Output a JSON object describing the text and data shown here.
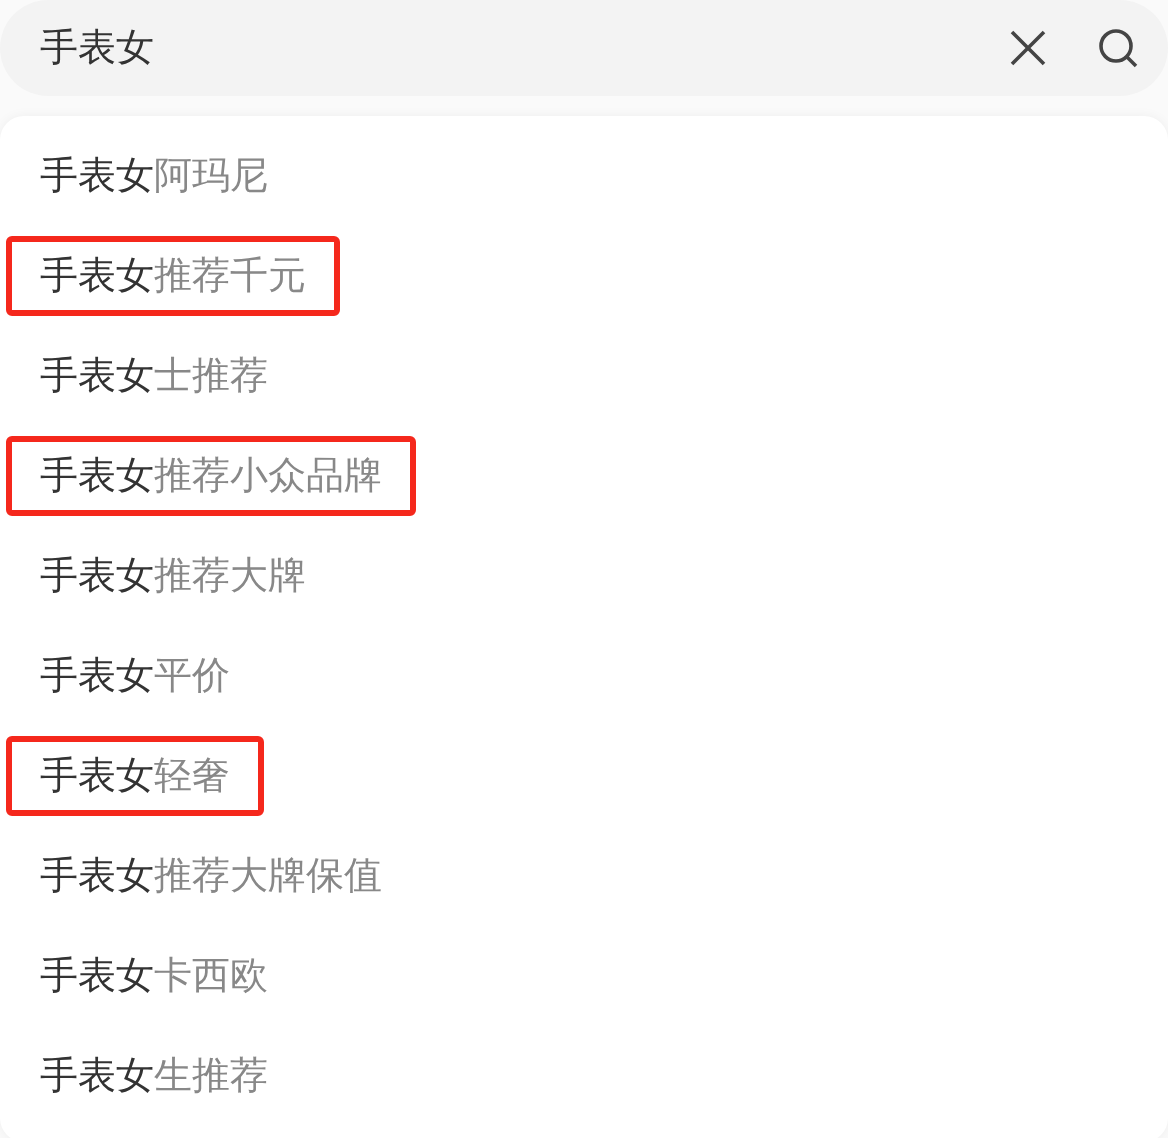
{
  "search": {
    "value": "手表女"
  },
  "suggestions": [
    {
      "query": "手表女",
      "completion": "阿玛尼",
      "highlighted": false
    },
    {
      "query": "手表女",
      "completion": "推荐千元",
      "highlighted": true
    },
    {
      "query": "手表女",
      "completion": "士推荐",
      "highlighted": false
    },
    {
      "query": "手表女",
      "completion": "推荐小众品牌",
      "highlighted": true
    },
    {
      "query": "手表女",
      "completion": "推荐大牌",
      "highlighted": false
    },
    {
      "query": "手表女",
      "completion": "平价",
      "highlighted": false
    },
    {
      "query": "手表女",
      "completion": "轻奢",
      "highlighted": true
    },
    {
      "query": "手表女",
      "completion": "推荐大牌保值",
      "highlighted": false
    },
    {
      "query": "手表女",
      "completion": "卡西欧",
      "highlighted": false
    },
    {
      "query": "手表女",
      "completion": "生推荐",
      "highlighted": false
    }
  ]
}
